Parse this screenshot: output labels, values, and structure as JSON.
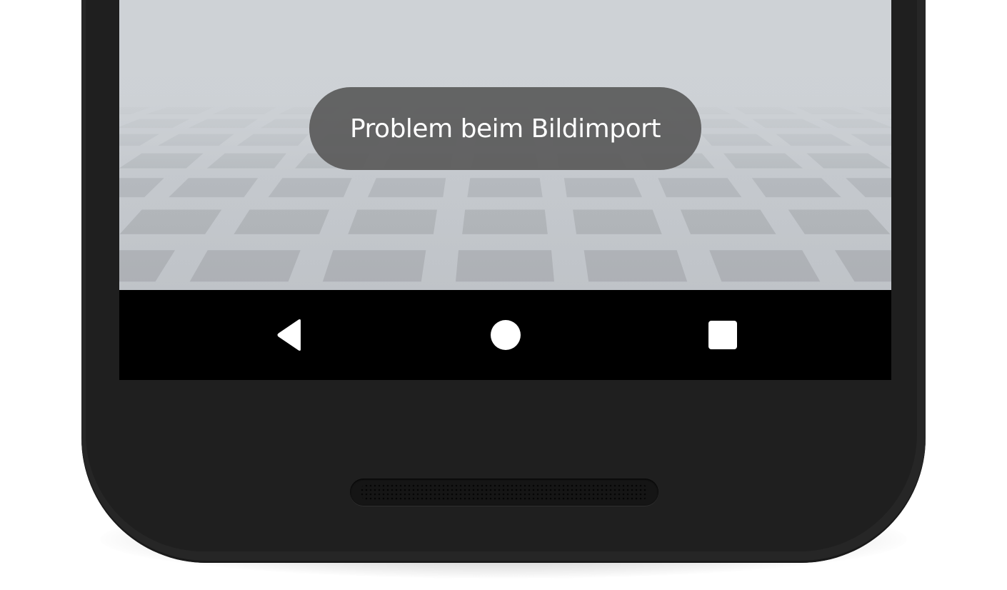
{
  "toast": {
    "message": "Problem beim Bildimport"
  },
  "navigation_bar": {
    "buttons": [
      {
        "name": "back",
        "icon": "back-triangle-icon"
      },
      {
        "name": "home",
        "icon": "home-circle-icon"
      },
      {
        "name": "recents",
        "icon": "recents-square-icon"
      }
    ]
  },
  "colors": {
    "toast_background": "#5a5a5a",
    "toast_text": "#ffffff",
    "navbar_background": "#000000",
    "nav_icon": "#ffffff",
    "device_bezel": "#1f1f1f",
    "wallpaper": "#c6cacf"
  }
}
